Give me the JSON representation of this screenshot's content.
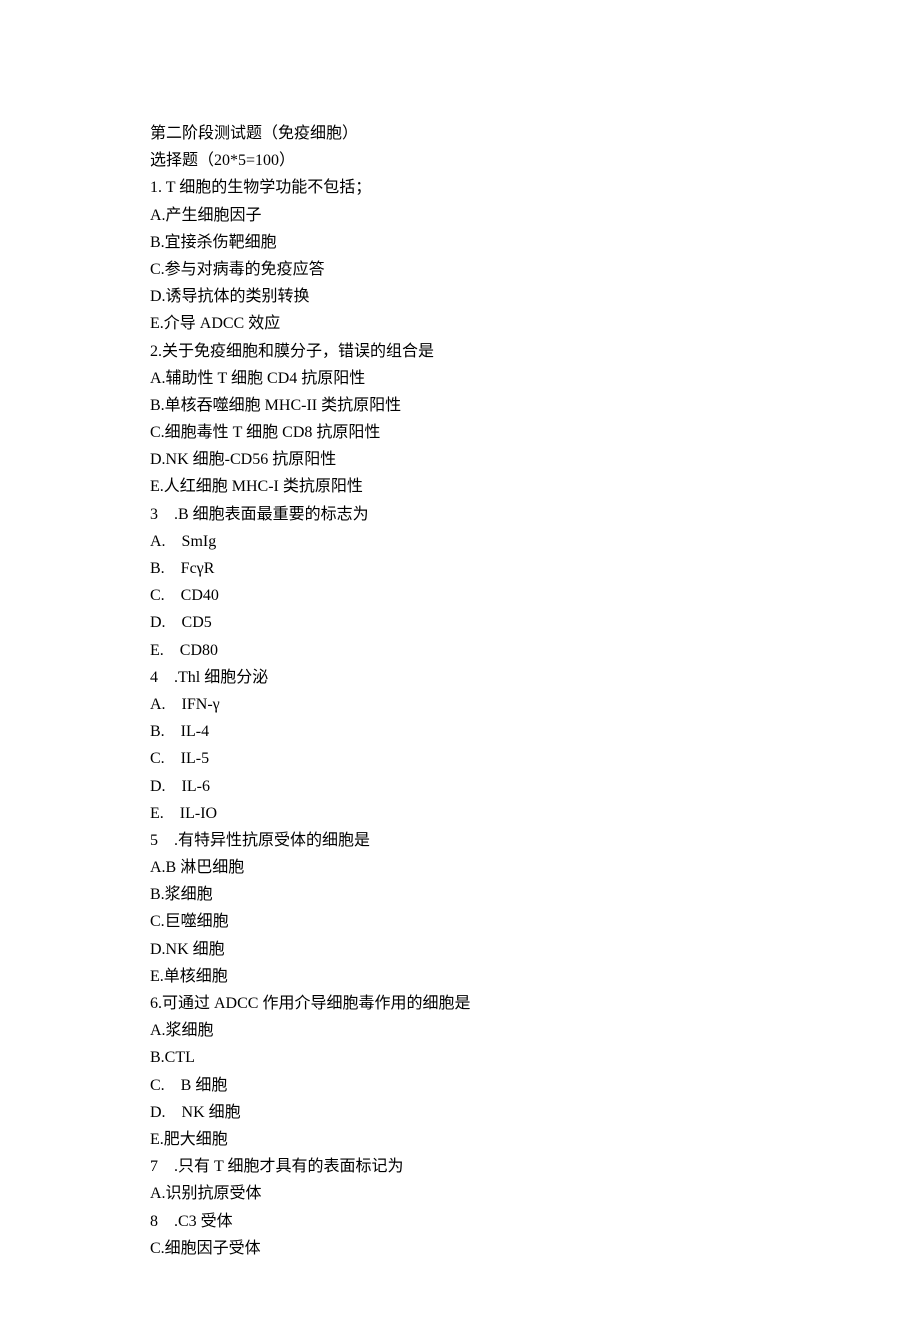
{
  "title": "第二阶段测试题（免疫细胞）",
  "subtitle": "选择题（20*5=100）",
  "questions": [
    {
      "stem": "1. T 细胞的生物学功能不包括；",
      "options": [
        "A.产生细胞因子",
        "B.宜接杀伤靶细胞",
        "C.参与对病毒的免疫应答",
        "D.诱导抗体的类别转换",
        "E.介导 ADCC 效应"
      ]
    },
    {
      "stem": "2.关于免疫细胞和膜分子，错误的组合是",
      "options": [
        "A.辅助性 T 细胞 CD4 抗原阳性",
        "B.单核吞噬细胞 MHC-II 类抗原阳性",
        "C.细胞毒性 T 细胞 CD8 抗原阳性",
        "D.NK 细胞-CD56 抗原阳性",
        "E.人红细胞 MHC-I 类抗原阳性"
      ]
    },
    {
      "stem": "3　.B 细胞表面最重要的标志为",
      "options": [
        "A.　SmIg",
        "B.　FcγR",
        "C.　CD40",
        "D.　CD5",
        "E.　CD80"
      ]
    },
    {
      "stem": "4　.Thl 细胞分泌",
      "options": [
        "A.　IFN-γ",
        "B.　IL-4",
        "C.　IL-5",
        "D.　IL-6",
        "E.　IL-IO"
      ]
    },
    {
      "stem": "5　.有特异性抗原受体的细胞是",
      "options": [
        "A.B 淋巴细胞",
        "B.浆细胞",
        "C.巨噬细胞",
        "D.NK 细胞",
        "E.单核细胞"
      ]
    },
    {
      "stem": "6.可通过 ADCC 作用介导细胞毒作用的细胞是",
      "options": [
        "A.浆细胞",
        "B.CTL",
        "C.　B 细胞",
        "D.　NK 细胞",
        "E.肥大细胞"
      ]
    },
    {
      "stem": "7　.只有 T 细胞才具有的表面标记为",
      "options": [
        "A.识别抗原受体",
        "8　.C3 受体",
        "C.细胞因子受体"
      ]
    }
  ]
}
